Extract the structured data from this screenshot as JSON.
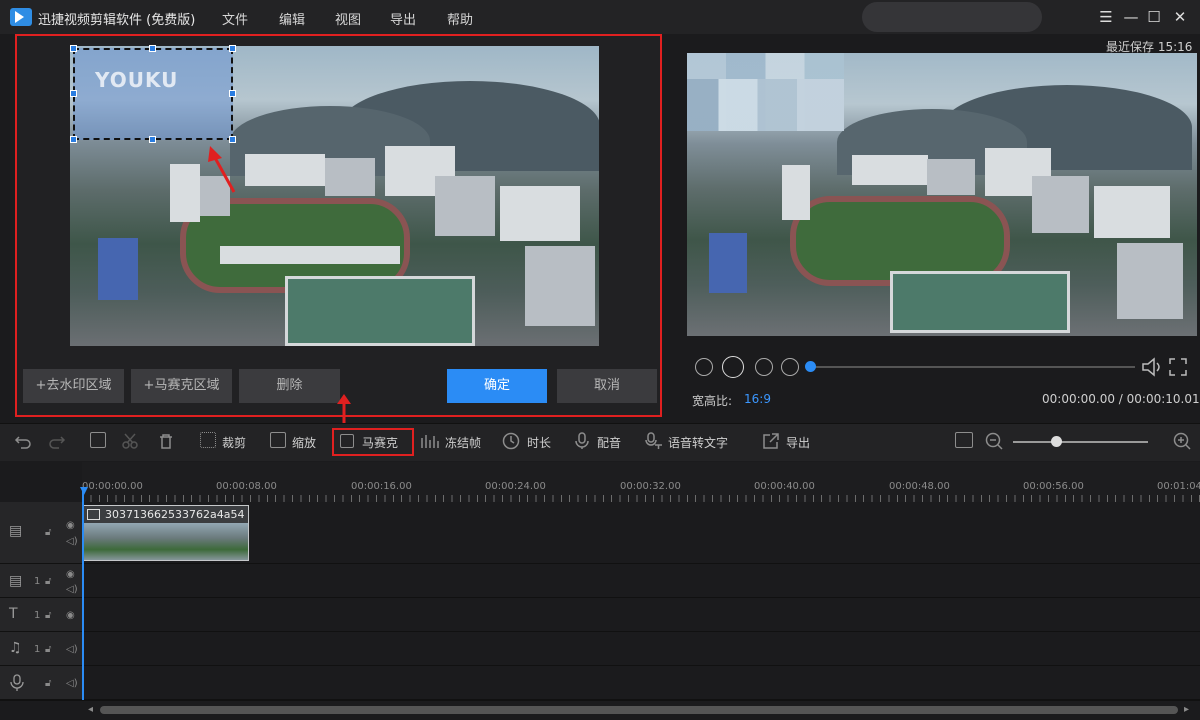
{
  "window": {
    "title": "迅捷视频剪辑软件 (免费版)",
    "menu": [
      "文件",
      "编辑",
      "视图",
      "导出",
      "帮助"
    ],
    "controls": {
      "menu": "☰",
      "minimize": "—",
      "maximize": "☐",
      "close": "✕"
    }
  },
  "editor": {
    "watermark_text": "YOUKU",
    "buttons": {
      "add_watermark_area": "+去水印区域",
      "add_mosaic_area": "+马赛克区域",
      "delete": "删除",
      "confirm": "确定",
      "cancel": "取消"
    }
  },
  "preview": {
    "last_save": "最近保存 15:16",
    "aspect_label": "宽高比:",
    "aspect_value": "16:9",
    "time_readout": "00:00:00.00 / 00:00:10.01",
    "progress": 0
  },
  "toolbar": {
    "crop": "裁剪",
    "zoom": "缩放",
    "mosaic": "马赛克",
    "freeze": "冻结帧",
    "duration": "时长",
    "dub": "配音",
    "speech_to_text": "语音转文字",
    "export": "导出"
  },
  "timeline": {
    "ticks": [
      "00:00:00.00",
      "00:00:08.00",
      "00:00:16.00",
      "00:00:24.00",
      "00:00:32.00",
      "00:00:40.00",
      "00:00:48.00",
      "00:00:56.00",
      "00:01:04"
    ],
    "clip_name": "303713662533762a4a54",
    "track_numbers": [
      "1",
      "1",
      "1"
    ]
  },
  "colors": {
    "accent": "#2b8cf5",
    "highlight": "#e02020"
  }
}
